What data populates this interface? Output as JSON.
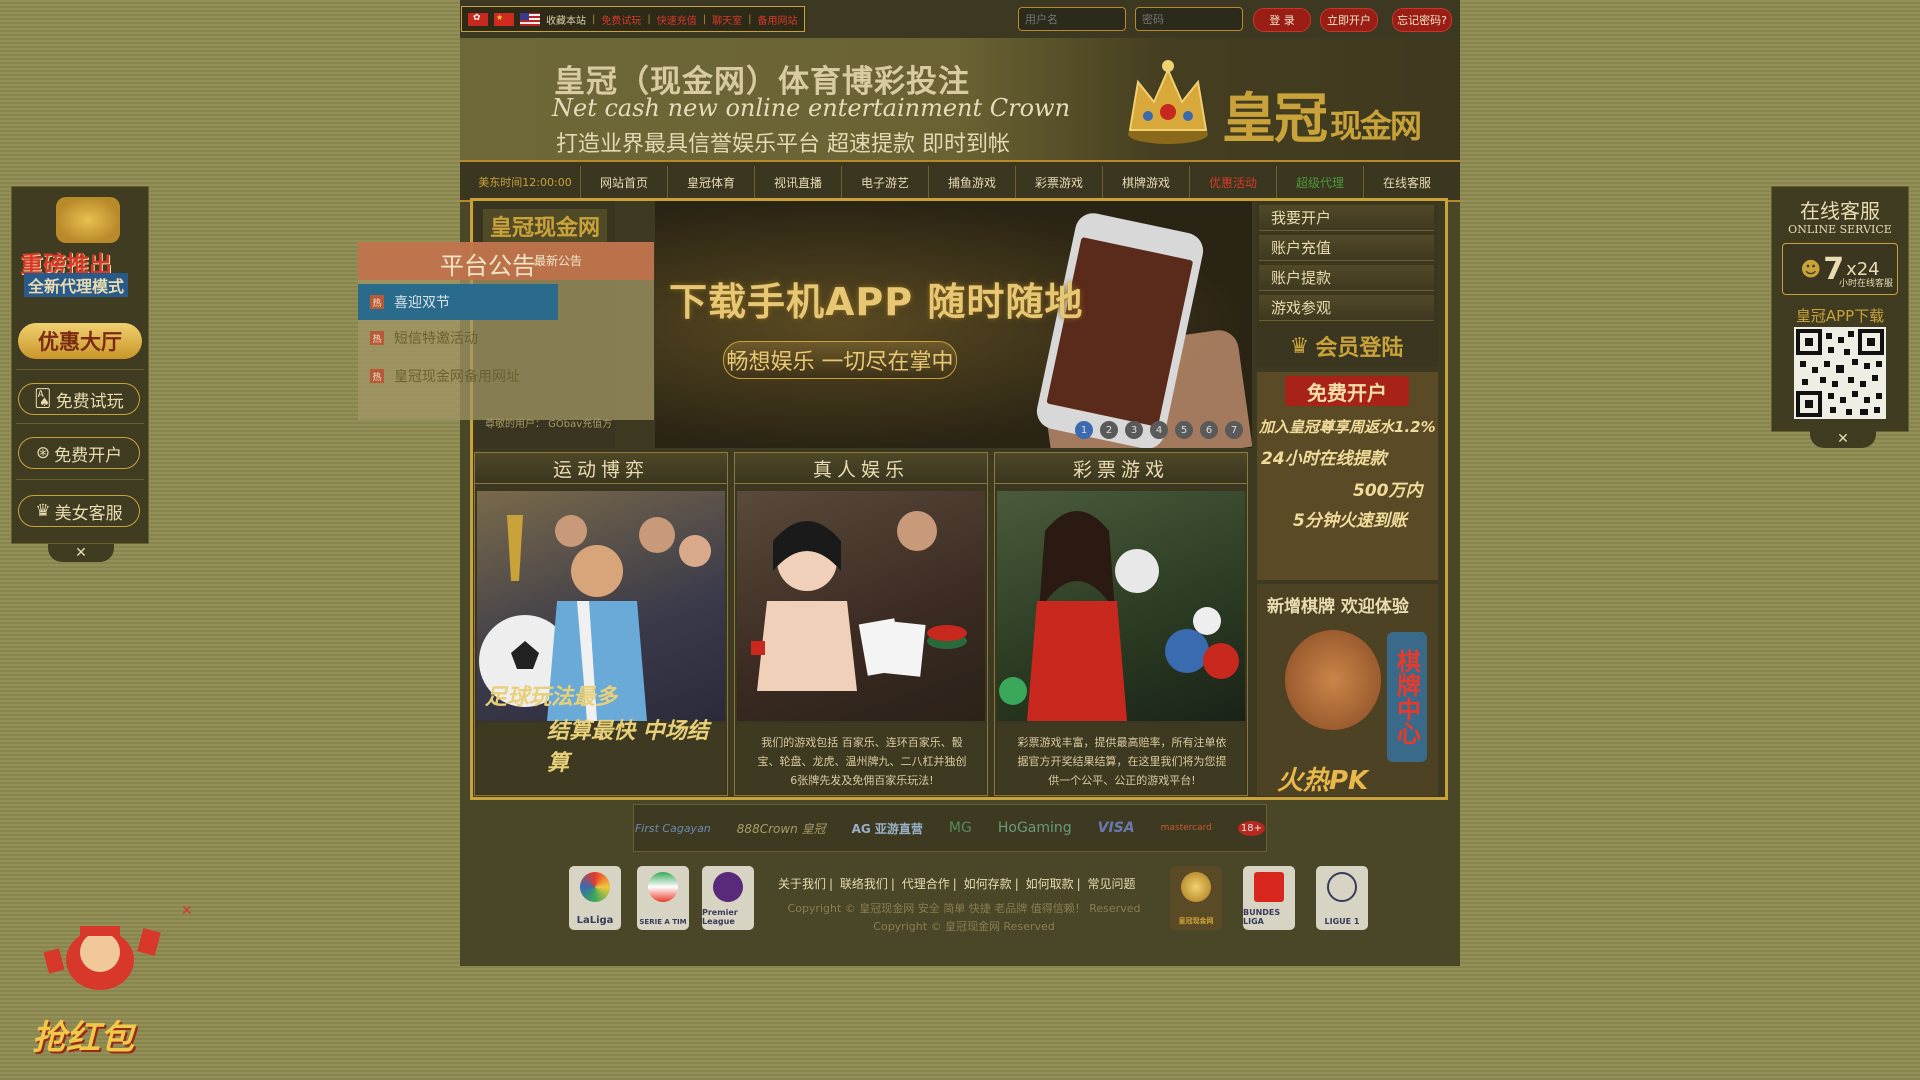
{
  "topbar": {
    "links": [
      "收藏本站",
      "免费试玩",
      "快速充值",
      "聊天室",
      "备用网站"
    ],
    "username_placeholder": "用户名",
    "password_placeholder": "密码",
    "login": "登 录",
    "register": "立即开户",
    "forgot": "忘记密码?"
  },
  "header": {
    "title": "皇冠（现金网）体育博彩投注",
    "subtitle": "Net cash new online entertainment Crown",
    "slogan": "打造业界最具信誉娱乐平台 超速提款 即时到帐",
    "brand_main": "皇冠",
    "brand_sub": "现金网"
  },
  "nav": {
    "time": "美东时间12:00:00",
    "items": [
      "网站首页",
      "皇冠体育",
      "视讯直播",
      "电子游艺",
      "捕鱼游戏",
      "彩票游戏",
      "棋牌游戏",
      "优惠活动",
      "超级代理",
      "在线客服"
    ]
  },
  "announcement": {
    "logo": "皇冠现金网",
    "popup_title": "平台公告",
    "popup_tag": "最新公告",
    "hot_label": "热",
    "items": [
      "喜迎双节",
      "短信特邀活动",
      "皇冠现金网备用网址"
    ],
    "footer": "尊敬的用户： GObav充值方"
  },
  "banner": {
    "title": "下载手机APP 随时随地",
    "sub": "畅想娱乐 一切尽在掌中",
    "dots": [
      "1",
      "2",
      "3",
      "4",
      "5",
      "6",
      "7"
    ]
  },
  "right_menu": {
    "items": [
      "我要开户",
      "账户充值",
      "账户提款",
      "游戏参观"
    ],
    "login": "会员登陆"
  },
  "promo": {
    "head": "免费开户",
    "lines": [
      "加入皇冠尊享周返水1.2%",
      "24小时在线提款",
      "500万内",
      "5分钟火速到账"
    ]
  },
  "chess": {
    "head": "新增棋牌 欢迎体验",
    "vertical": "棋牌中心",
    "pk": "火热PK"
  },
  "cards": [
    {
      "title": "运动博弈",
      "slogan1": "足球玩法最多",
      "slogan2": "结算最快 中场结算"
    },
    {
      "title": "真人娱乐",
      "text": "我们的游戏包括 百家乐、连环百家乐、骰宝、轮盘、龙虎、温州牌九、二八杠并独创6张牌先发及免佣百家乐玩法!"
    },
    {
      "title": "彩票游戏",
      "text": "彩票游戏丰富，提供最高赔率，所有注单依据官方开奖结果结算，在这里我们将为您提供一个公平、公正的游戏平台!"
    }
  ],
  "partners": [
    "First Cagayan",
    "888Crown 皇冠",
    "AG 亚游直营",
    "MG",
    "HoGaming",
    "VISA",
    "mastercard",
    "18+"
  ],
  "footer": {
    "leagues": [
      "LaLiga",
      "SERIE A TIM",
      "Premier League",
      "皇冠现金网",
      "BUNDES LIGA",
      "LIGUE 1"
    ],
    "links": [
      "关于我们",
      "联络我们",
      "代理合作",
      "如何存款",
      "如何取款",
      "常见问题"
    ],
    "copy1": "Copyright © 皇冠现金网 安全 简单 快捷 老品牌 值得信赖！ Reserved",
    "copy2": "Copyright © 皇冠现金网 Reserved"
  },
  "left_float": {
    "big": "重磅推出",
    "mid": "全新代理模式",
    "hall": "优惠大厅",
    "buttons": [
      "免费试玩",
      "免费开户",
      "美女客服"
    ],
    "close": "✕"
  },
  "right_float": {
    "title": "在线客服",
    "en": "ONLINE SERVICE",
    "num": "7",
    "x24": "x24",
    "small": "小时在线客服",
    "app": "皇冠APP下载",
    "close": "✕"
  },
  "envelope": {
    "text": "抢红包",
    "close": "✕"
  }
}
